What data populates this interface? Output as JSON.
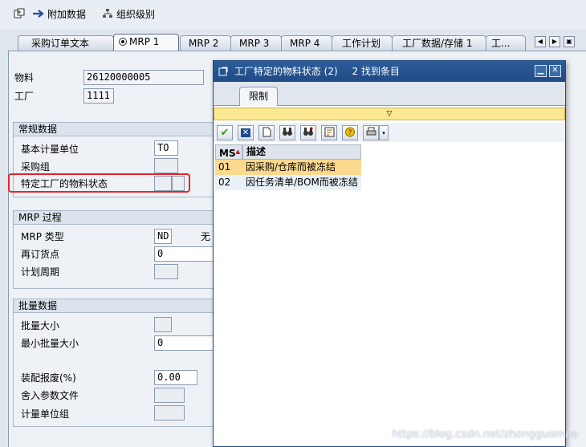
{
  "toolbar": {
    "additional_data": "附加数据",
    "org_levels": "组织级别"
  },
  "tabs": [
    {
      "label": "采购订单文本"
    },
    {
      "label": "MRP 1"
    },
    {
      "label": "MRP 2"
    },
    {
      "label": "MRP 3"
    },
    {
      "label": "MRP 4"
    },
    {
      "label": "工作计划"
    },
    {
      "label": "工厂数据/存储 1"
    },
    {
      "label": "工..."
    }
  ],
  "header_fields": {
    "material_label": "物料",
    "material_value": "26120000005",
    "plant_label": "工厂",
    "plant_value": "1111"
  },
  "general_data": {
    "title": "常规数据",
    "base_uom_label": "基本计量单位",
    "base_uom_value": "TO",
    "purch_group_label": "采购组",
    "plant_status_label": "特定工厂的物料状态"
  },
  "mrp_procedure": {
    "title": "MRP 过程",
    "mrp_type_label": "MRP 类型",
    "mrp_type_value": "ND",
    "mrp_type_desc": "无",
    "reorder_label": "再订货点",
    "reorder_value": "0",
    "plan_cycle_label": "计划周期"
  },
  "lot_size": {
    "title": "批量数据",
    "lot_size_label": "批量大小",
    "min_lot_label": "最小批量大小",
    "min_lot_value": "0",
    "assembly_scrap_label": "装配报废(%)",
    "assembly_scrap_value": "0.00",
    "rounding_profile_label": "舍入参数文件",
    "uom_group_label": "计量单位组"
  },
  "dialog": {
    "title": "工厂特定的物料状态 (2)",
    "found": "2 找到条目",
    "tab_label": "限制",
    "expander": "▽",
    "columns": [
      "MS",
      "描述"
    ],
    "rows": [
      {
        "code": "01",
        "desc": "因采购/仓库而被冻结"
      },
      {
        "code": "02",
        "desc": "因任务清单/BOM而被冻结"
      }
    ]
  },
  "watermark": "https://blog.csdn.net/zhongguomao"
}
